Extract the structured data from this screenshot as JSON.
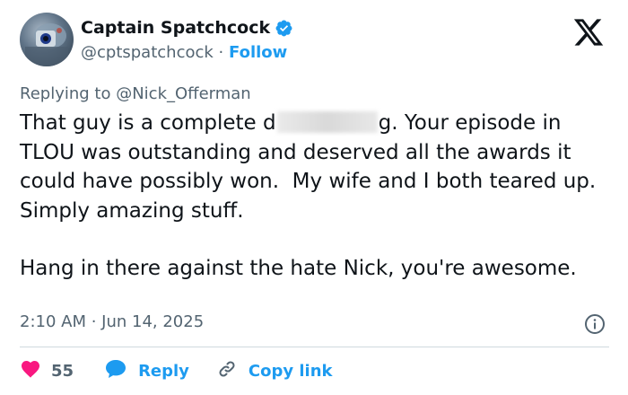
{
  "author": {
    "name": "Captain Spatchcock",
    "handle": "@cptspatchcock",
    "separator": "·",
    "follow_label": "Follow",
    "verified_icon": "verified-badge-icon"
  },
  "platform": {
    "logo_icon": "x-logo-icon"
  },
  "reply_context": {
    "prefix": "Replying to",
    "mention": "@Nick_Offerman"
  },
  "tweet": {
    "text_part1": "That guy is a complete d",
    "redacted_note": "blurred word",
    "text_part2": "g. Your episode in TLOU was outstanding and deserved all the awards it could have possibly won.  My wife and I both teared up. Simply amazing stuff.",
    "text_para2": "Hang in there against the hate Nick, you're awesome."
  },
  "meta": {
    "timestamp": "2:10 AM · Jun 14, 2025"
  },
  "actions": {
    "likes_count": "55",
    "reply_label": "Reply",
    "copy_link_label": "Copy link"
  },
  "colors": {
    "accent": "#1d9bf0",
    "like": "#f91880",
    "muted": "#536471",
    "text": "#0f1419"
  }
}
